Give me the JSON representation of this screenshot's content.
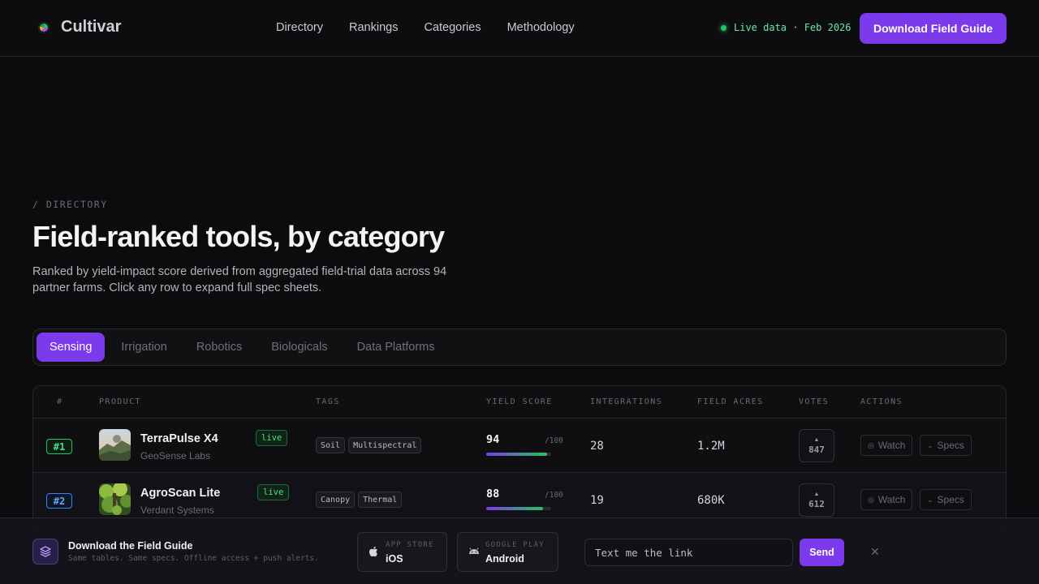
{
  "brand": {
    "name": "Cultivar"
  },
  "nav": {
    "links": [
      "Directory",
      "Rankings",
      "Categories",
      "Methodology"
    ],
    "live_status": "Live data · Feb 2026",
    "cta": "Download Field Guide"
  },
  "hero": {
    "eyebrow": "/ DIRECTORY",
    "title": "Field-ranked tools, by category",
    "description": "Ranked by yield-impact score derived from aggregated field-trial data across 94 partner farms. Click any row to expand full spec sheets."
  },
  "tabs": [
    "Sensing",
    "Irrigation",
    "Robotics",
    "Biologicals",
    "Data Platforms"
  ],
  "active_tab": "Sensing",
  "table": {
    "columns": [
      "#",
      "PRODUCT",
      "TAGS",
      "YIELD SCORE",
      "INTEGRATIONS",
      "FIELD ACRES",
      "VOTES",
      "ACTIONS"
    ],
    "rows": [
      {
        "rank": "#1",
        "rank_color": "#22c55e",
        "name": "TerraPulse X4",
        "badge": "live",
        "company": "GeoSense Labs",
        "tags": [
          "Soil",
          "Multispectral"
        ],
        "score": "94",
        "score_max": "/100",
        "score_fraction": 0.94,
        "integrations": "28",
        "acres": "1.2M",
        "votes": "847",
        "watch": "Watch",
        "specs": "Specs"
      },
      {
        "rank": "#2",
        "rank_color": "#3b82f6",
        "name": "AgroScan Lite",
        "badge": "live",
        "company": "Verdant Systems",
        "tags": [
          "Canopy",
          "Thermal"
        ],
        "score": "88",
        "score_max": "/100",
        "score_fraction": 0.88,
        "integrations": "19",
        "acres": "680K",
        "votes": "612",
        "watch": "Watch",
        "specs": "Specs"
      }
    ]
  },
  "banner": {
    "title": "Download the Field Guide",
    "subtitle": "Same tables. Same specs. Offline access + push alerts.",
    "ios_kicker": "APP STORE",
    "ios_name": "iOS",
    "android_kicker": "GOOGLE PLAY",
    "android_name": "Android",
    "input_placeholder": "Text me the link",
    "send": "Send",
    "close": "✕"
  },
  "colors": {
    "accent": "#7c3aed",
    "live": "#22c55e",
    "background": "#0c0c0e"
  },
  "icons": {
    "watch": "eye-icon",
    "specs": "chevron-down-icon",
    "vote": "upvote-arrow-icon",
    "ios": "apple-icon",
    "android": "android-icon",
    "banner": "layers-icon"
  }
}
